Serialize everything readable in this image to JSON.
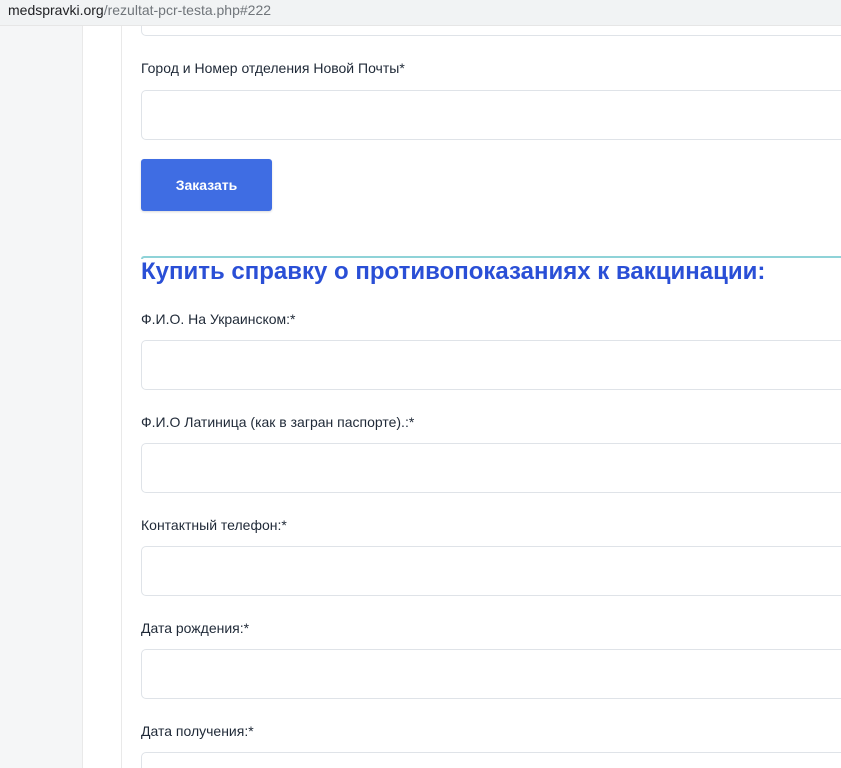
{
  "browser": {
    "url_host": "medspravki.org",
    "url_path": "/rezultat-pcr-testa.php#222"
  },
  "form_top": {
    "city_label": "Город и Номер отделения Новой Почты*",
    "city_value": "",
    "order_button_label": "Заказать"
  },
  "section": {
    "title": "Купить справку о противопоказаниях к вакцинации:"
  },
  "fields": [
    {
      "label": "Ф.И.О. На Украинском:*",
      "value": ""
    },
    {
      "label": "Ф.И.О Латиница (как в загран паспорте).:*",
      "value": ""
    },
    {
      "label": "Контактный телефон:*",
      "value": ""
    },
    {
      "label": "Дата рождения:*",
      "value": ""
    },
    {
      "label": "Дата получения:*",
      "value": ""
    }
  ],
  "colors": {
    "accent_button": "#3f6de3",
    "section_title": "#2a4fd6",
    "divider": "#8fd3d8"
  }
}
